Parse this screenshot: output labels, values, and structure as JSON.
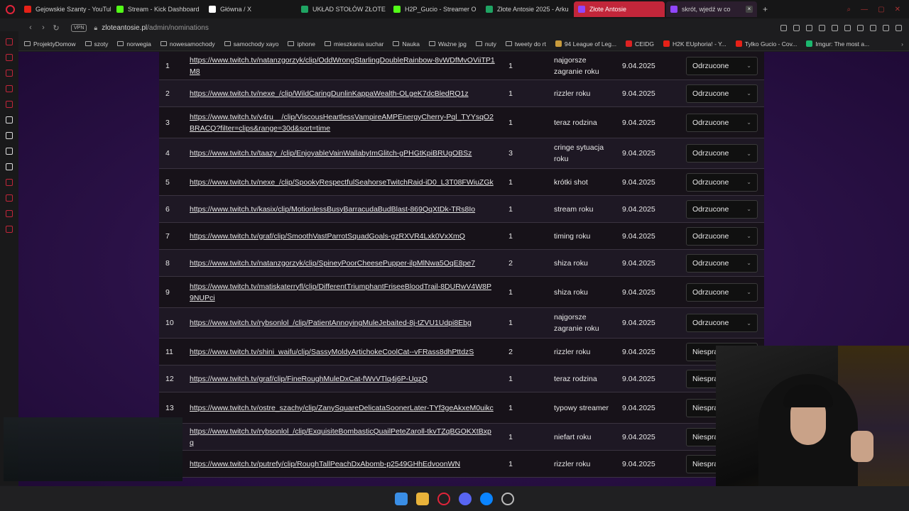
{
  "tabs": [
    {
      "title": "Gejowskie Szanty - YouTube",
      "color": "#e62117"
    },
    {
      "title": "Stream - Kick Dashboard",
      "color": "#53fc18"
    },
    {
      "title": "Główna / X",
      "color": "#ffffff"
    },
    {
      "title": "UKŁAD STOŁÓW ZŁOTE",
      "color": "#1fa463"
    },
    {
      "title": "H2P_Gucio - Streamer O",
      "color": "#53fc18"
    },
    {
      "title": "Złote Antosie 2025 - Arku",
      "color": "#1fa463"
    },
    {
      "title": "Złote Antosie",
      "color": "#9146ff"
    },
    {
      "title": "skrót, wjedź w co",
      "color": "#9146ff"
    }
  ],
  "address": {
    "host": "zloteantosie.pl",
    "path": "/admin/nominations",
    "vpn_label": "VPN"
  },
  "bookmarks": [
    {
      "label": "ProjektyDomow",
      "kind": "folder"
    },
    {
      "label": "szoty",
      "kind": "folder"
    },
    {
      "label": "norwegia",
      "kind": "folder"
    },
    {
      "label": "nowesamochody",
      "kind": "folder"
    },
    {
      "label": "samochody xayo",
      "kind": "folder"
    },
    {
      "label": "iphone",
      "kind": "folder"
    },
    {
      "label": "mieszkania suchar",
      "kind": "folder"
    },
    {
      "label": "Nauka",
      "kind": "folder"
    },
    {
      "label": "Ważne jpg",
      "kind": "folder"
    },
    {
      "label": "nuty",
      "kind": "folder"
    },
    {
      "label": "tweety do rt",
      "kind": "folder"
    },
    {
      "label": "94 League of Leg...",
      "kind": "site",
      "color": "#c89b3c"
    },
    {
      "label": "CEIDG",
      "kind": "site",
      "color": "#d22"
    },
    {
      "label": "H2K EUphoria! - Y...",
      "kind": "site",
      "color": "#e62117"
    },
    {
      "label": "Tylko Gucio - Cov...",
      "kind": "site",
      "color": "#e62117"
    },
    {
      "label": "Imgur: The most a...",
      "kind": "site",
      "color": "#1bb76e"
    }
  ],
  "nominations": [
    {
      "num": "1",
      "url": "https://www.twitch.tv/natanzgorzyk/clip/OddWrongStarlingDoubleRainbow-8vWDfMvOViiTP1M8",
      "count": "1",
      "category": "najgorsze zagranie roku",
      "date": "9.04.2025",
      "status": "Odrzucone"
    },
    {
      "num": "2",
      "url": "https://www.twitch.tv/nexe_/clip/WildCaringDunlinKappaWealth-OLgeK7dcBledRQ1z",
      "count": "1",
      "category": "rizzler roku",
      "date": "9.04.2025",
      "status": "Odrzucone"
    },
    {
      "num": "3",
      "url": "https://www.twitch.tv/v4ru__/clip/ViscousHeartlessVampireAMPEnergyCherry-Pql_TYYsqO2BRACQ?filter=clips&range=30d&sort=time",
      "count": "1",
      "category": "teraz rodzina",
      "date": "9.04.2025",
      "status": "Odrzucone"
    },
    {
      "num": "4",
      "url": "https://www.twitch.tv/taazy_/clip/EnjoyableVainWallabyImGlitch-gPHGtKpiBRUgOBSz",
      "count": "3",
      "category": "cringe sytuacja roku",
      "date": "9.04.2025",
      "status": "Odrzucone"
    },
    {
      "num": "5",
      "url": "https://www.twitch.tv/nexe_/clip/SpookyRespectfulSeahorseTwitchRaid-iD0_L3T08FWiuZGk",
      "count": "1",
      "category": "krótki shot",
      "date": "9.04.2025",
      "status": "Odrzucone"
    },
    {
      "num": "6",
      "url": "https://www.twitch.tv/kasix/clip/MotionlessBusyBarracudaBudBlast-869QqXtDk-TRs8Io",
      "count": "1",
      "category": "stream roku",
      "date": "9.04.2025",
      "status": "Odrzucone"
    },
    {
      "num": "7",
      "url": "https://www.twitch.tv/graf/clip/SmoothVastParrotSquadGoals-gzRXVR4Lxk0VxXmQ",
      "count": "1",
      "category": "timing roku",
      "date": "9.04.2025",
      "status": "Odrzucone"
    },
    {
      "num": "8",
      "url": "https://www.twitch.tv/natanzgorzyk/clip/SpineyPoorCheesePupper-ilpMlNwa5OqE8pe7",
      "count": "2",
      "category": "shiza roku",
      "date": "9.04.2025",
      "status": "Odrzucone"
    },
    {
      "num": "9",
      "url": "https://www.twitch.tv/matiskaterryfl/clip/DifferentTriumphantFriseeBloodTrail-8DURwV4W8P9NUPci",
      "count": "1",
      "category": "shiza roku",
      "date": "9.04.2025",
      "status": "Odrzucone"
    },
    {
      "num": "10",
      "url": "https://www.twitch.tv/rybsonlol_/clip/PatientAnnoyingMuleJebaited-8j-tZVU1Udpi8Ebg",
      "count": "1",
      "category": "najgorsze zagranie roku",
      "date": "9.04.2025",
      "status": "Odrzucone"
    },
    {
      "num": "11",
      "url": "https://www.twitch.tv/shini_waifu/clip/SassyMoldyArtichokeCoolCat--vFRass8dhPttdzS",
      "count": "2",
      "category": "rizzler roku",
      "date": "9.04.2025",
      "status": "Niesprawdzone"
    },
    {
      "num": "12",
      "url": "https://www.twitch.tv/graf/clip/FineRoughMuleDxCat-fWvVTlq4j6P-UqzQ",
      "count": "1",
      "category": "teraz rodzina",
      "date": "9.04.2025",
      "status": "Niesprawdzone"
    },
    {
      "num": "13",
      "url": "https://www.twitch.tv/ostre_szachy/clip/ZanySquareDelicataSoonerLater-TYf3geAkxeM0uikc",
      "count": "1",
      "category": "typowy streamer",
      "date": "9.04.2025",
      "status": "Niesprawdzone"
    },
    {
      "num": "",
      "url": "https://www.twitch.tv/rybsonlol_/clip/ExquisiteBombasticQuailPeteZaroll-tkvTZqBGOKXtBxpq",
      "count": "1",
      "category": "niefart roku",
      "date": "9.04.2025",
      "status": "Niesprawdzone"
    },
    {
      "num": "",
      "url": "https://www.twitch.tv/putrefy/clip/RoughTallPeachDxAbomb-p2549GHhEdvoonWN",
      "count": "1",
      "category": "rizzler roku",
      "date": "9.04.2025",
      "status": "Niesprawdzone"
    }
  ]
}
